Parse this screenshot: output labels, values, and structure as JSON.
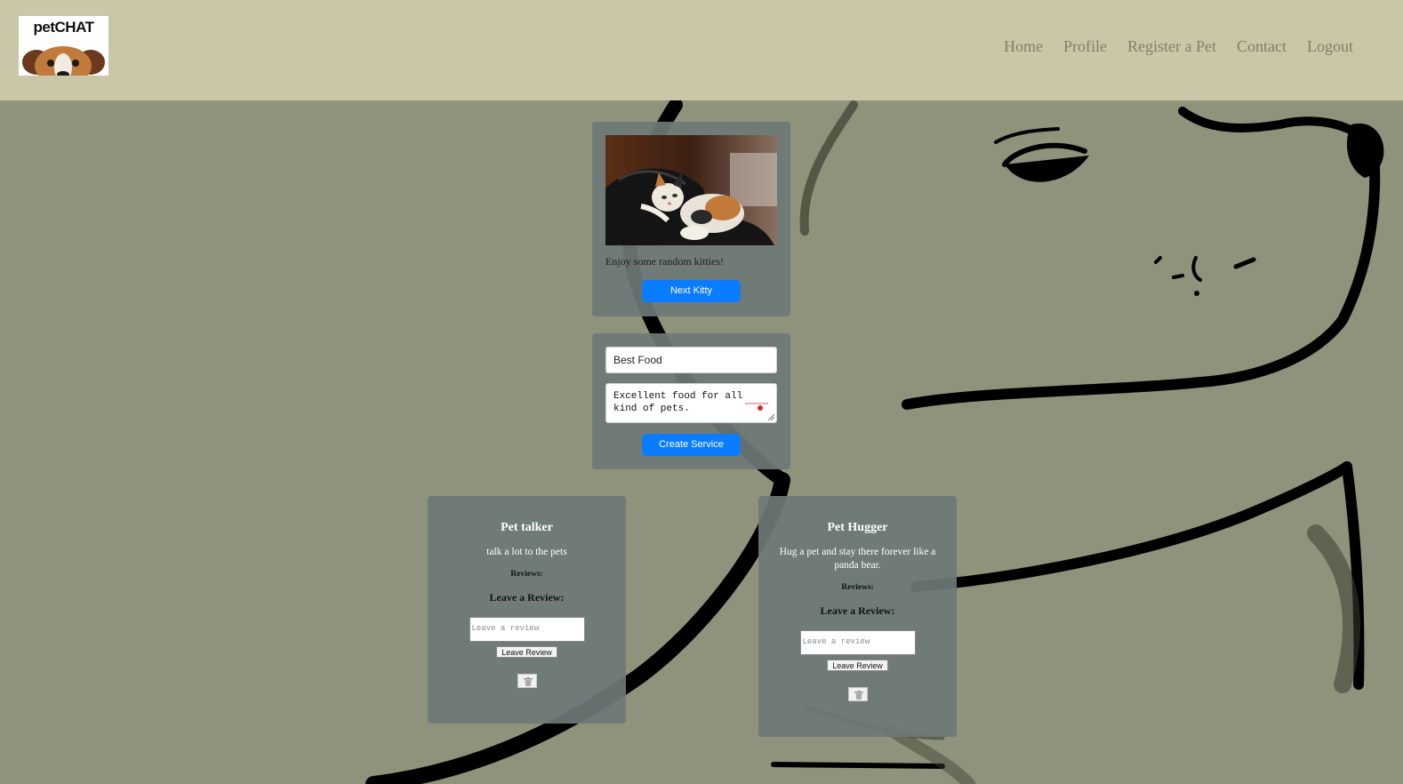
{
  "header": {
    "logo_text": "petCHAT",
    "nav": [
      "Home",
      "Profile",
      "Register a Pet",
      "Contact",
      "Logout"
    ]
  },
  "kitty_card": {
    "caption": "Enjoy some random kitties!",
    "button_label": "Next Kitty"
  },
  "service_form": {
    "name_value": "Best Food",
    "description_value": "Excellent food for all kind of pets.",
    "button_label": "Create Service"
  },
  "services": [
    {
      "title": "Pet talker",
      "description": "talk a lot to the pets",
      "reviews_label": "Reviews:",
      "leave_review_heading": "Leave a Review:",
      "review_placeholder": "Leave a review",
      "review_button_label": "Leave Review",
      "delete_icon": "trash-icon"
    },
    {
      "title": "Pet Hugger",
      "description": "Hug a pet and stay there forever like a panda bear.",
      "reviews_label": "Reviews:",
      "leave_review_heading": "Leave a Review:",
      "review_placeholder": "Leave a review",
      "review_button_label": "Leave Review",
      "delete_icon": "trash-icon"
    }
  ],
  "colors": {
    "header_bg": "#c9c7a7",
    "page_bg": "#8f937b",
    "card_bg": "#6e7876",
    "button_blue": "#0a7cff",
    "nav_text": "#80806c"
  }
}
